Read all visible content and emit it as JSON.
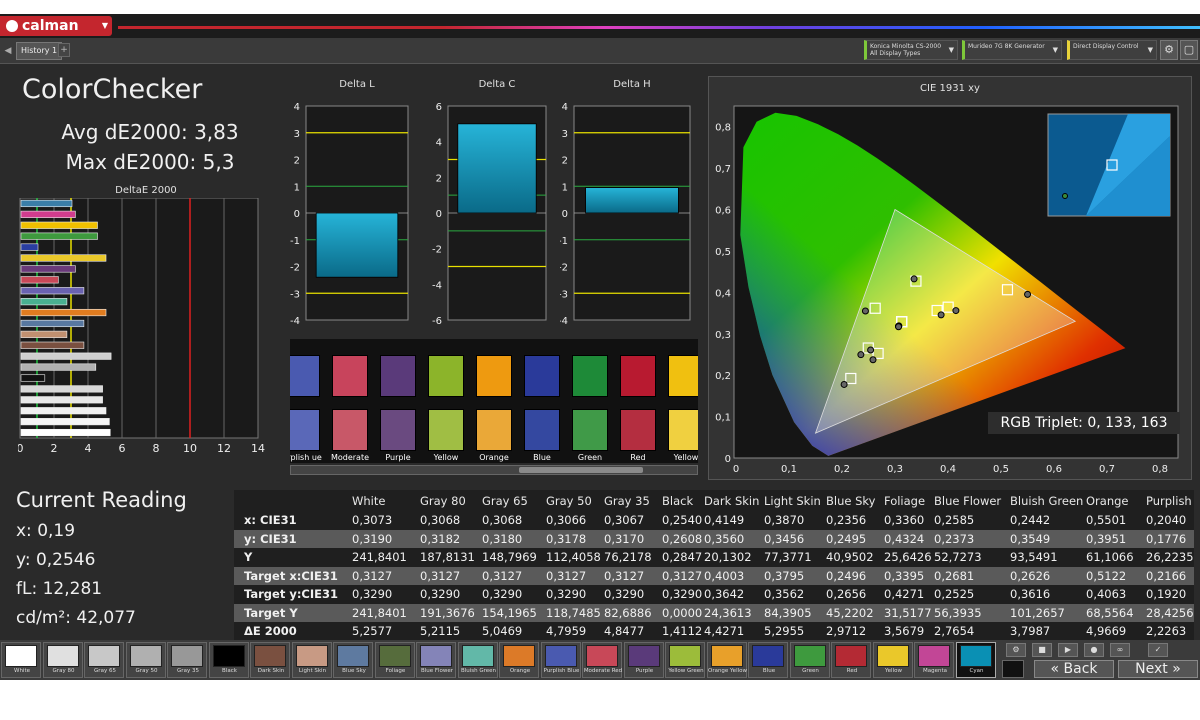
{
  "app": {
    "logo": "calman",
    "tab": "History 1",
    "tab_add": "+"
  },
  "devices": [
    {
      "line1": "Konica Minolta CS-2000",
      "line2": "All Display Types",
      "accent": "#7ec83a"
    },
    {
      "line1": "Murideo 7G 8K Generator",
      "line2": "",
      "accent": "#7ec83a"
    },
    {
      "line1": "Direct Display Control",
      "line2": "",
      "accent": "#e8d33a"
    }
  ],
  "summary": {
    "title": "ColorChecker",
    "avg": "Avg dE2000: 3,83",
    "max": "Max dE2000: 5,3",
    "deltae_title": "DeltaE 2000",
    "deltae_ticks": [
      "0",
      "2",
      "4",
      "6",
      "8",
      "10",
      "12",
      "14"
    ],
    "deltae_values": [
      3.0,
      3.2,
      4.5,
      4.5,
      1.0,
      5.0,
      3.2,
      2.2,
      3.7,
      2.7,
      5.0,
      3.7,
      2.7,
      3.7,
      5.3,
      4.4,
      1.4,
      4.8,
      4.8,
      5.0,
      5.2,
      5.25
    ],
    "deltae_colors": [
      "#3a7ea8",
      "#d13c8e",
      "#f0c000",
      "#3e9a3e",
      "#2a3ea0",
      "#eac82a",
      "#6a3a7a",
      "#c84858",
      "#6a62b0",
      "#4ab090",
      "#e07c20",
      "#5878a0",
      "#c09070",
      "#7a5040",
      "#cfcfcf",
      "#b0b0b0",
      "#111111",
      "#d8d8d8",
      "#e8e8e8",
      "#f0f0f0",
      "#f5f5f5",
      "#ffffff"
    ]
  },
  "delta_l": {
    "title": "Delta L",
    "ticks": [
      "4",
      "3",
      "2",
      "1",
      "0",
      "-1",
      "-2",
      "-3",
      "-4"
    ],
    "value": -2.4
  },
  "delta_c": {
    "title": "Delta C",
    "ticks": [
      "6",
      "4",
      "2",
      "0",
      "-2",
      "-4",
      "-6"
    ],
    "value": 5.0
  },
  "delta_h": {
    "title": "Delta H",
    "ticks": [
      "4",
      "3",
      "2",
      "1",
      "0",
      "-1",
      "-2",
      "-3",
      "-4"
    ],
    "value": 0.95
  },
  "patches": {
    "labels": [
      "urplish\nue",
      "Moderate\nRed",
      "Purple",
      "Yellow\nGreen",
      "Orange\nYellow",
      "Blue",
      "Green",
      "Red",
      "Yellow"
    ],
    "actual": [
      "#4a5ab0",
      "#c8445c",
      "#5a3a7a",
      "#8cb42a",
      "#ee9a10",
      "#2a3a9a",
      "#1e8a38",
      "#b81a30",
      "#f0c010"
    ],
    "target": [
      "#5a68b8",
      "#c85868",
      "#6a4a80",
      "#a0be44",
      "#eaa838",
      "#3448a0",
      "#409a48",
      "#b42e40",
      "#f0d040"
    ]
  },
  "cie": {
    "title": "CIE 1931 xy",
    "xticks": [
      "0",
      "0,1",
      "0,2",
      "0,3",
      "0,4",
      "0,5",
      "0,6",
      "0,7",
      "0,8"
    ],
    "yticks": [
      "0,8",
      "0,7",
      "0,6",
      "0,5",
      "0,4",
      "0,3",
      "0,2",
      "0,1",
      "0"
    ],
    "triplet": "RGB Triplet: 0, 133, 163",
    "inset_color": "#1f8fd0"
  },
  "current": {
    "title": "Current Reading",
    "x": "x: 0,19",
    "y": "y: 0,2546",
    "fl": "fL: 12,281",
    "cdm": "cd/m²: 42,077"
  },
  "table": {
    "columns": [
      "White",
      "Gray 80",
      "Gray 65",
      "Gray 50",
      "Gray 35",
      "Black",
      "Dark Skin",
      "Light Skin",
      "Blue Sky",
      "Foliage",
      "Blue Flower",
      "Bluish Green",
      "Orange",
      "Purplish"
    ],
    "rows": [
      {
        "label": "x: CIE31",
        "values": [
          "0,3073",
          "0,3068",
          "0,3068",
          "0,3066",
          "0,3067",
          "0,2540",
          "0,4149",
          "0,3870",
          "0,2356",
          "0,3360",
          "0,2585",
          "0,2442",
          "0,5501",
          "0,2040"
        ]
      },
      {
        "label": "y: CIE31",
        "values": [
          "0,3190",
          "0,3182",
          "0,3180",
          "0,3178",
          "0,3170",
          "0,2608",
          "0,3560",
          "0,3456",
          "0,2495",
          "0,4324",
          "0,2373",
          "0,3549",
          "0,3951",
          "0,1776"
        ]
      },
      {
        "label": "Y",
        "values": [
          "241,8401",
          "187,8131",
          "148,7969",
          "112,4058",
          "76,2178",
          "0,2847",
          "20,1302",
          "77,3771",
          "40,9502",
          "25,6426",
          "52,7273",
          "93,5491",
          "61,1066",
          "26,2235"
        ]
      },
      {
        "label": "Target x:CIE31",
        "values": [
          "0,3127",
          "0,3127",
          "0,3127",
          "0,3127",
          "0,3127",
          "0,3127",
          "0,4003",
          "0,3795",
          "0,2496",
          "0,3395",
          "0,2681",
          "0,2626",
          "0,5122",
          "0,2166"
        ]
      },
      {
        "label": "Target y:CIE31",
        "values": [
          "0,3290",
          "0,3290",
          "0,3290",
          "0,3290",
          "0,3290",
          "0,3290",
          "0,3642",
          "0,3562",
          "0,2656",
          "0,4271",
          "0,2525",
          "0,3616",
          "0,4063",
          "0,1920"
        ]
      },
      {
        "label": "Target Y",
        "values": [
          "241,8401",
          "191,3676",
          "154,1965",
          "118,7485",
          "82,6886",
          "0,0000",
          "24,3613",
          "84,3905",
          "45,2202",
          "31,5177",
          "56,3935",
          "101,2657",
          "68,5564",
          "28,4256"
        ]
      },
      {
        "label": "ΔE 2000",
        "values": [
          "5,2577",
          "5,2115",
          "5,0469",
          "4,7959",
          "4,8477",
          "1,4112",
          "4,4271",
          "5,2955",
          "2,9712",
          "3,5679",
          "2,7654",
          "3,7987",
          "4,9669",
          "2,2263"
        ]
      }
    ]
  },
  "strip": [
    {
      "label": "White",
      "color": "#ffffff"
    },
    {
      "label": "Gray 80",
      "color": "#e0e0e0"
    },
    {
      "label": "Gray 65",
      "color": "#c8c8c8"
    },
    {
      "label": "Gray 50",
      "color": "#b0b0b0"
    },
    {
      "label": "Gray 35",
      "color": "#989898"
    },
    {
      "label": "Black",
      "color": "#000000"
    },
    {
      "label": "Dark Skin",
      "color": "#7a5040"
    },
    {
      "label": "Light Skin",
      "color": "#c89a84"
    },
    {
      "label": "Blue Sky",
      "color": "#5e7aa0"
    },
    {
      "label": "Foliage",
      "color": "#566c3c"
    },
    {
      "label": "Blue Flower",
      "color": "#8484b8"
    },
    {
      "label": "Bluish Green",
      "color": "#62b8a8"
    },
    {
      "label": "Orange",
      "color": "#dc7a28"
    },
    {
      "label": "Purplish Blue",
      "color": "#4a5ab0"
    },
    {
      "label": "Moderate Red",
      "color": "#c84858"
    },
    {
      "label": "Purple",
      "color": "#5a3a7a"
    },
    {
      "label": "Yellow Green",
      "color": "#9cbc3a"
    },
    {
      "label": "Orange Yellow",
      "color": "#e8a02a"
    },
    {
      "label": "Blue",
      "color": "#2a3a9a"
    },
    {
      "label": "Green",
      "color": "#3e9a3e"
    },
    {
      "label": "Red",
      "color": "#b42a34"
    },
    {
      "label": "Yellow",
      "color": "#eac82a"
    },
    {
      "label": "Magenta",
      "color": "#c24696"
    },
    {
      "label": "Cyan",
      "color": "#0a90b4"
    }
  ],
  "nav": {
    "back": "Back",
    "next": "Next"
  }
}
